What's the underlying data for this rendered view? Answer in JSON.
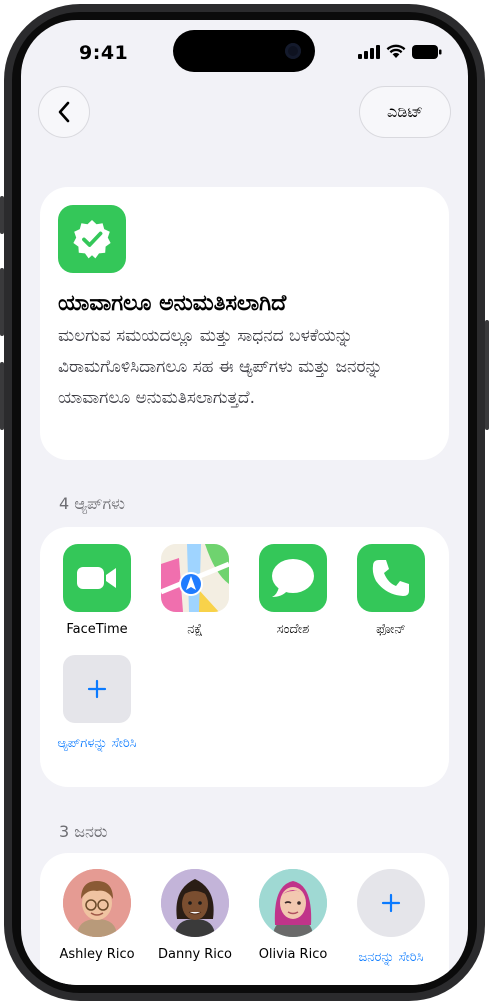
{
  "status_bar": {
    "time": "9:41"
  },
  "nav": {
    "edit_label": "ಎಡಿಟ್"
  },
  "permission": {
    "title": "ಯಾವಾಗಲೂ ಅನುಮತಿಸಲಾಗಿದೆ",
    "description": "ಮಲಗುವ ಸಮಯದಲ್ಲೂ ಮತ್ತು ಸಾಧನದ ಬಳಕೆಯನ್ನು ವಿರಾಮಗೊಳಿಸಿದಾಗಲೂ ಸಹ ಈ ಆ್ಯಪ್‌ಗಳು ಮತ್ತು ಜನರನ್ನು ಯಾವಾಗಲೂ ಅನುಮತಿಸಲಾಗುತ್ತದೆ."
  },
  "apps_section": {
    "header": "4 ಆ್ಯಪ್‌ಗಳು",
    "apps": [
      {
        "label": "FaceTime",
        "icon": "facetime-icon"
      },
      {
        "label": "ನಕ್ಷೆ",
        "icon": "maps-icon"
      },
      {
        "label": "ಸಂದೇಶ",
        "icon": "messages-icon"
      },
      {
        "label": "ಫೋನ್",
        "icon": "phone-icon"
      }
    ],
    "add_label": "ಆ್ಯಪ್‌ಗಳನ್ನು ಸೇರಿಸಿ"
  },
  "people_section": {
    "header": "3 ಜನರು",
    "people": [
      {
        "name": "Ashley Rico",
        "icon": "memoji-avatar"
      },
      {
        "name": "Danny Rico",
        "icon": "memoji-avatar"
      },
      {
        "name": "Olivia Rico",
        "icon": "memoji-avatar"
      }
    ],
    "add_label": "ಜನರನ್ನು ಸೇರಿಸಿ"
  },
  "colors": {
    "accent": "#0a7aff",
    "badge_green": "#34c759",
    "background": "#f2f2f7"
  }
}
